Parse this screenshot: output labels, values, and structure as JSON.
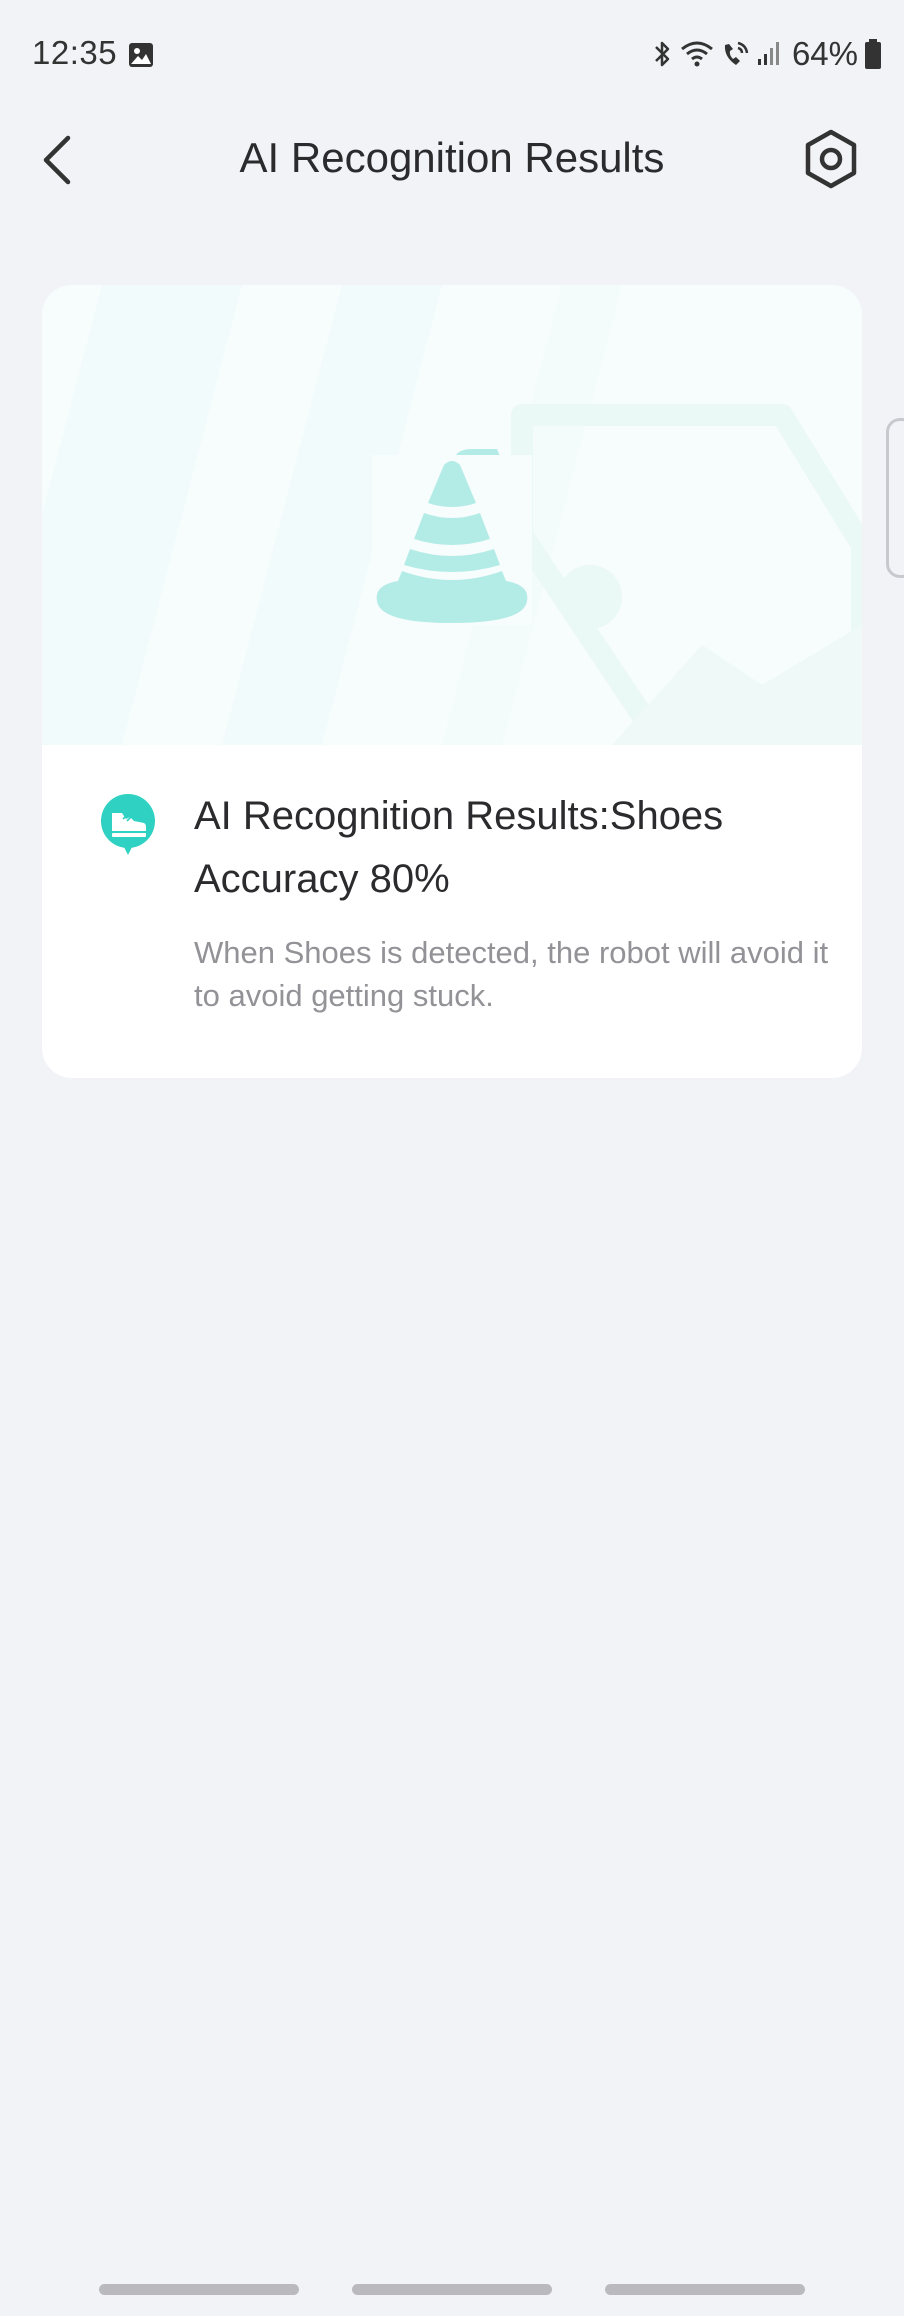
{
  "status_bar": {
    "time": "12:35",
    "battery": "64%",
    "icons": [
      "gallery-icon",
      "bluetooth-icon",
      "wifi-icon",
      "wifi-call-icon",
      "signal-icon",
      "battery-icon"
    ]
  },
  "header": {
    "title": "AI Recognition Results",
    "back_icon": "chevron-left-icon",
    "settings_icon": "hexagon-gear-icon"
  },
  "card": {
    "illustration": "traffic-cone-icon",
    "result_icon": "shoe-badge-icon",
    "title_line1": "AI Recognition Results:Shoes",
    "title_line2": "Accuracy 80%",
    "description": "When Shoes is detected, the robot will avoid it to avoid getting stuck."
  },
  "colors": {
    "accent": "#2ed1c2",
    "cone": "#b3ece6",
    "background": "#f2f3f7",
    "card": "#ffffff",
    "title_text": "#2b2b2e",
    "secondary_text": "#929297"
  }
}
